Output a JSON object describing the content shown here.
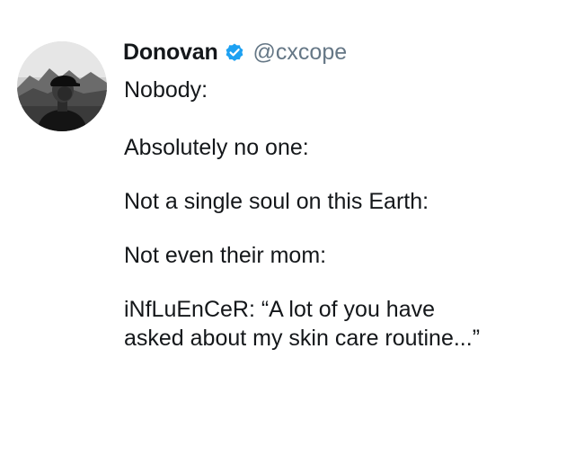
{
  "tweet": {
    "author": {
      "name": "Donovan",
      "handle": "@cxcope",
      "verified": true,
      "verified_color": "#1da1f2"
    },
    "lines": [
      "Nobody:",
      "Absolutely no one:",
      "Not a single soul on this Earth:",
      "Not even their mom:",
      "iNfLuEnCeR: “A lot of you have",
      "asked about my skin care routine...”"
    ]
  }
}
